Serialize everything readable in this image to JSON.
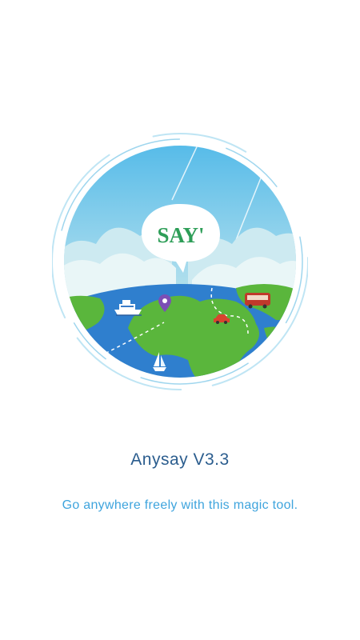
{
  "splash": {
    "logo_text": "SAY'",
    "app_name": "Anysay V3.3",
    "tagline": "Go anywhere freely with this magic tool."
  },
  "colors": {
    "title": "#2b5d8e",
    "tagline": "#3ea4dd",
    "ring": "#a9dcef",
    "sky_top": "#4cb8e8",
    "sky_bottom": "#dff1d2",
    "ocean": "#2e7fd0",
    "land": "#58b83b",
    "logo_green": "#2e9e58"
  },
  "icons": [
    "globe-illustration",
    "speech-bubble-icon",
    "ship-icon",
    "map-pin-icon",
    "bus-icon",
    "car-icon",
    "sailboat-icon"
  ]
}
